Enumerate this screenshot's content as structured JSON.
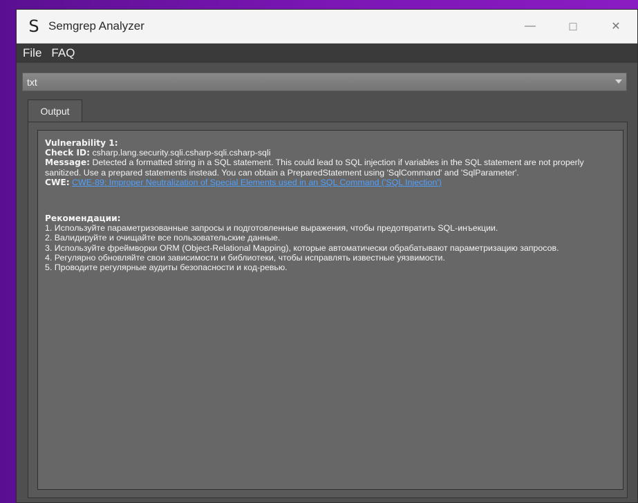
{
  "window": {
    "icon_letter": "S",
    "title": "Semgrep Analyzer",
    "controls": {
      "minimize": "—",
      "maximize": "□",
      "close": "✕"
    }
  },
  "menu": {
    "items": [
      "File",
      "FAQ"
    ]
  },
  "selector": {
    "value": "txt"
  },
  "tabs": [
    {
      "label": "Output"
    }
  ],
  "output": {
    "vulnerability_heading": "Vulnerability 1:",
    "check_id_label": "Check ID:",
    "check_id": "csharp.lang.security.sqli.csharp-sqli.csharp-sqli",
    "message_label": "Message:",
    "message": "Detected a formatted string in a SQL statement. This could lead to SQL injection if variables in the SQL statement are not properly sanitized. Use a prepared statements instead. You can obtain a PreparedStatement using 'SqlCommand' and 'SqlParameter'.",
    "cwe_label": "CWE:",
    "cwe_link": "CWE-89: Improper Neutralization of Special Elements used in an SQL Command ('SQL Injection')",
    "recommendations_heading": "Рекомендации:",
    "recommendations": [
      "1. Используйте параметризованные запросы и подготовленные выражения, чтобы предотвратить SQL-инъекции.",
      "2. Валидируйте и очищайте все пользовательские данные.",
      "3. Используйте фреймворки ORM (Object-Relational Mapping), которые автоматически обрабатывают параметризацию запросов.",
      "4. Регулярно обновляйте свои зависимости и библиотеки, чтобы исправлять известные уязвимости.",
      "5. Проводите регулярные аудиты безопасности и код-ревью."
    ]
  },
  "colors": {
    "background_accent": "#7b16b4",
    "window_bg": "#4f4f4f",
    "output_bg": "#676767",
    "link": "#4fa0ff"
  }
}
